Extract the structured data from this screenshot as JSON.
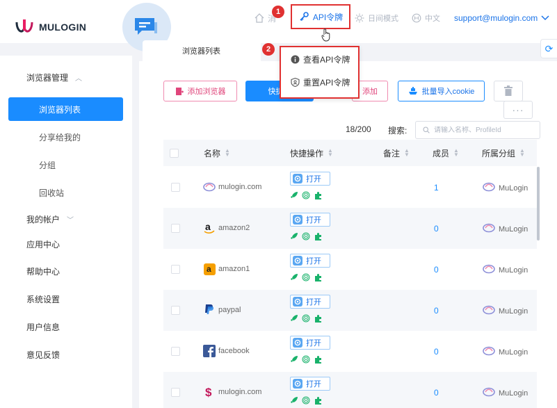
{
  "header": {
    "logo_text": "MULOGIN",
    "api_token_label": "API令牌",
    "theme_label": "日间模式",
    "lang_label": "中文",
    "email": "support@mulogin.com",
    "partial_item": "消"
  },
  "tabs": [
    {
      "label": "浏览器列表"
    }
  ],
  "sidebar": {
    "items": [
      {
        "label": "浏览器管理",
        "level": 1,
        "expanded": true
      },
      {
        "label": "浏览器列表",
        "level": 2,
        "active": true
      },
      {
        "label": "分享给我的",
        "level": 2
      },
      {
        "label": "分组",
        "level": 2
      },
      {
        "label": "回收站",
        "level": 2
      },
      {
        "label": "我的帐户",
        "level": 1,
        "expanded": false
      },
      {
        "label": "应用中心",
        "level": 1
      },
      {
        "label": "帮助中心",
        "level": 1
      },
      {
        "label": "系统设置",
        "level": 1
      },
      {
        "label": "用户信息",
        "level": 1
      },
      {
        "label": "意见反馈",
        "level": 1
      }
    ]
  },
  "toolbar": {
    "add_browser": "添加浏览器",
    "quick_create": "快捷创",
    "add_partial": "添加",
    "import_cookie": "批量导入cookie"
  },
  "dropdown": {
    "view_token": "查看API令牌",
    "reset_token": "重置API令牌"
  },
  "steps": {
    "one": "1",
    "two": "2"
  },
  "list": {
    "count": "18/200",
    "search_label": "搜索:",
    "search_placeholder": "请输入名称、ProfileId"
  },
  "table": {
    "headers": {
      "name": "名称",
      "actions": "快捷操作",
      "note": "备注",
      "members": "成员",
      "group": "所属分组"
    },
    "open_label": "打开",
    "rows": [
      {
        "name": "mulogin.com",
        "icon": "mulogin-icon",
        "members": "1",
        "group": "MuLogin"
      },
      {
        "name": "amazon2",
        "icon": "amazon-icon",
        "members": "0",
        "group": "MuLogin"
      },
      {
        "name": "amazon1",
        "icon": "amazon-box-icon",
        "members": "0",
        "group": "MuLogin"
      },
      {
        "name": "paypal",
        "icon": "paypal-icon",
        "members": "0",
        "group": "MuLogin"
      },
      {
        "name": "facebook",
        "icon": "facebook-icon",
        "members": "0",
        "group": "MuLogin"
      },
      {
        "name": "mulogin.com",
        "icon": "dollar-icon",
        "members": "0",
        "group": "MuLogin"
      }
    ]
  },
  "colors": {
    "primary": "#1a8cff",
    "pink": "#e0457b",
    "highlight_red": "#e03131",
    "green_icons": "#19b26b"
  }
}
